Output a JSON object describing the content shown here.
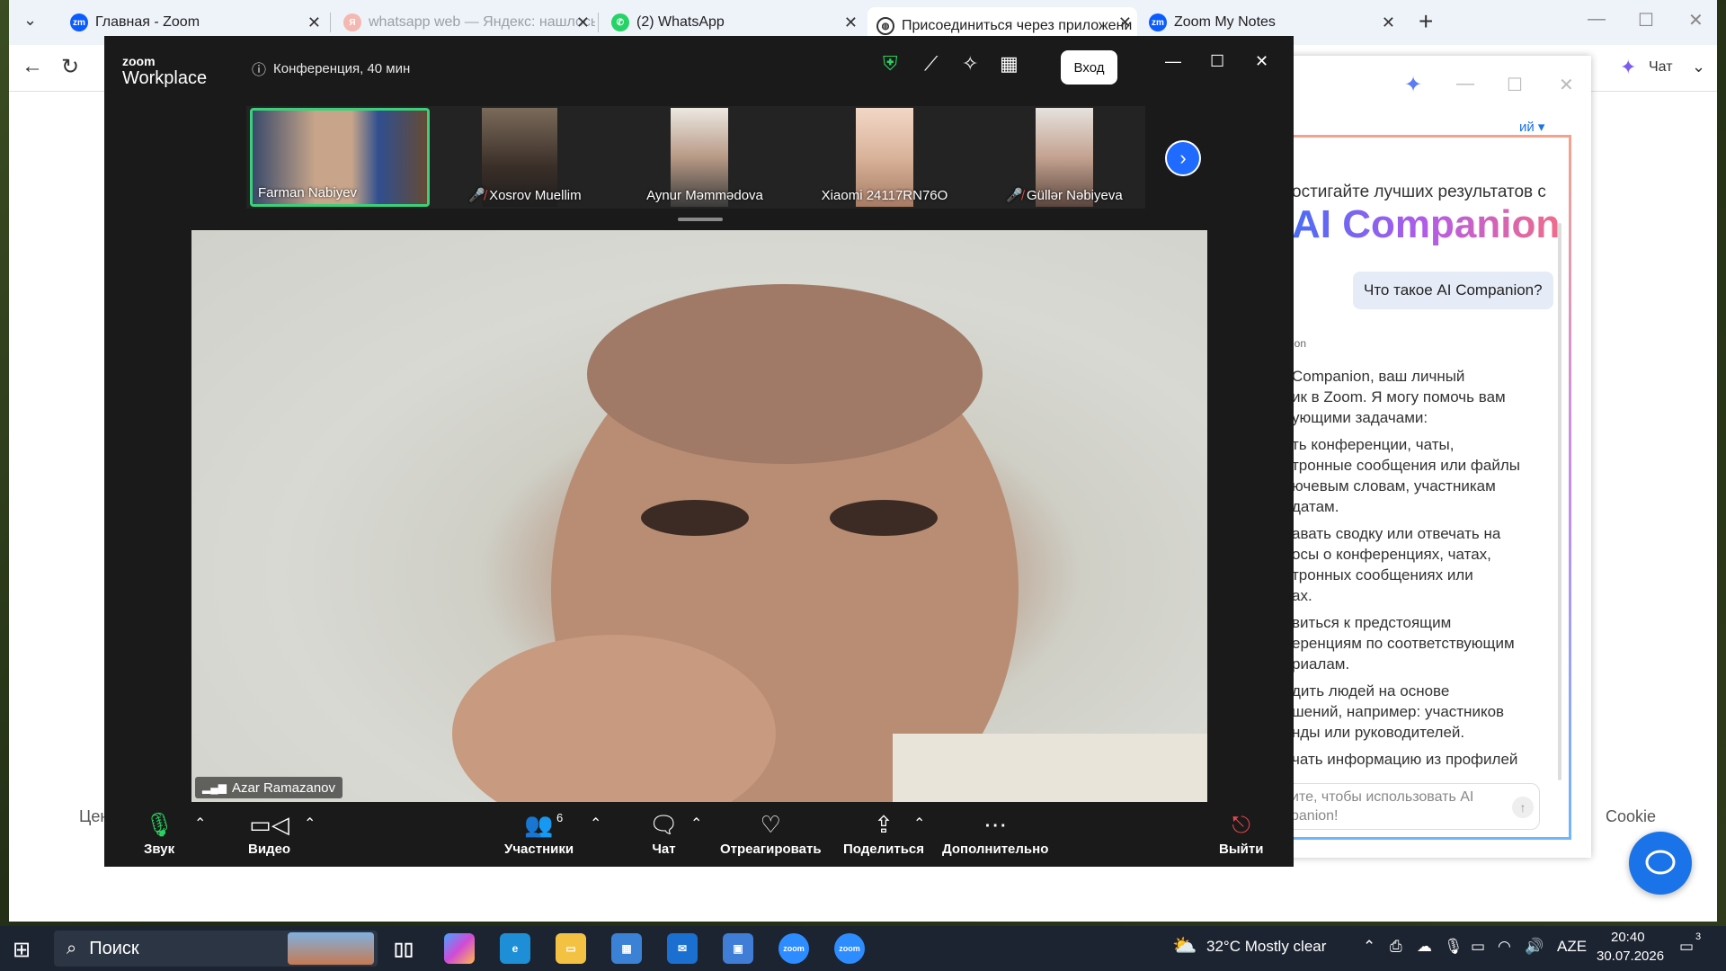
{
  "browser": {
    "tabs": [
      {
        "label": "Главная - Zoom",
        "icon": "zoom-icon",
        "faded": false
      },
      {
        "label": "whatsapp web — Яндекс: нашлось",
        "icon": "yandex-icon",
        "faded": true
      },
      {
        "label": "(2) WhatsApp",
        "icon": "whatsapp-icon",
        "faded": false
      },
      {
        "label": "Присоединиться через приложени",
        "icon": "globe-icon",
        "faded": false
      },
      {
        "label": "Zoom My Notes",
        "icon": "zoom-icon",
        "faded": false
      }
    ],
    "chat_label": "Чат",
    "page_fragment_left": "Цен",
    "page_fragment_right": "Cookie"
  },
  "ai_companion": {
    "headline_top": "остигайте лучших результатов с",
    "headline_brand": "AI Companion",
    "dropdown_fragment": "ий",
    "question": "Что такое AI Companion?",
    "section_label": "ion",
    "answer_lines": [
      "Companion, ваш личный",
      "ик в Zoom. Я могу помочь вам",
      "ующими задачами:",
      "ть конференции, чаты,",
      "тронные сообщения или файлы",
      "ючевым словам, участникам",
      "датам.",
      "авать сводку или отвечать на",
      "осы о конференциях, чатах,",
      "тронных сообщениях или",
      "ах.",
      "виться к предстоящим",
      "еренциям по соответствующим",
      "риалам.",
      "дить людей на основе",
      "шений, например: участников",
      "нды или руководителей.",
      "чать информацию из профилей"
    ],
    "input_placeholder_line1": "ите, чтобы использовать AI",
    "input_placeholder_line2": "panion!"
  },
  "zoom": {
    "logo_top": "zoom",
    "logo_bottom": "Workplace",
    "meeting_info": "Конференция, 40 мин",
    "signin_label": "Вход",
    "participants_strip": [
      {
        "name": "Farman Nabiyev",
        "muted": false,
        "active": true
      },
      {
        "name": "Xosrov Muellim",
        "muted": true,
        "active": false
      },
      {
        "name": "Aynur Məmmədova",
        "muted": false,
        "active": false
      },
      {
        "name": "Xiaomi 24117RN76O",
        "muted": false,
        "active": false
      },
      {
        "name": "Güllər Nəbiyeva",
        "muted": true,
        "active": false
      }
    ],
    "main_speaker": "Azar Ramazanov",
    "controls": {
      "audio": "Звук",
      "video": "Видео",
      "participants": "Участники",
      "participants_count": "6",
      "chat": "Чат",
      "react": "Отреагировать",
      "share": "Поделиться",
      "more": "Дополнительно",
      "leave": "Выйти"
    }
  },
  "taskbar": {
    "search_placeholder": "Поиск",
    "weather": "32°C  Mostly clear",
    "language": "AZE",
    "time": "20:40",
    "date": "30.07.2026",
    "notification_count": "3"
  },
  "colors": {
    "zoom_blue": "#1f6bff",
    "active_green": "#3ad17a",
    "muted_red": "#e0474c"
  }
}
